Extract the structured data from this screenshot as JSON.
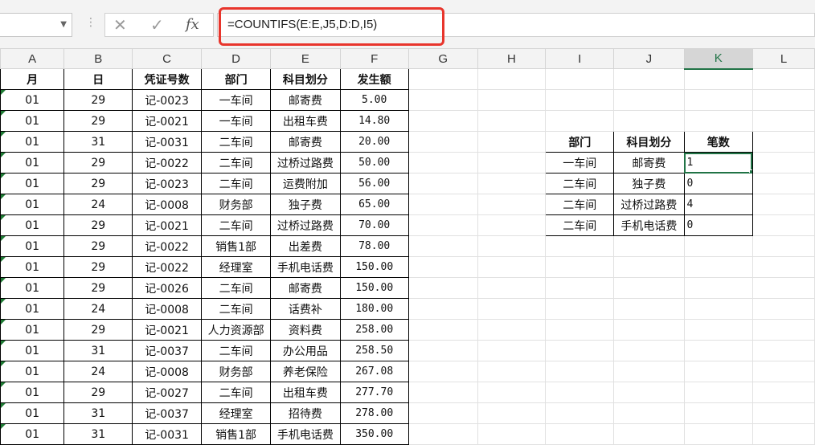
{
  "formula_bar": {
    "name_box": "",
    "cancel_icon": "✕",
    "enter_icon": "✓",
    "fx_label": "fx",
    "formula": "=COUNTIFS(E:E,J5,D:D,I5)"
  },
  "columns": [
    "A",
    "B",
    "C",
    "D",
    "E",
    "F",
    "G",
    "H",
    "I",
    "J",
    "K",
    "L"
  ],
  "selected_column": "K",
  "headers": {
    "month": "月",
    "day": "日",
    "voucher": "凭证号数",
    "dept": "部门",
    "subject": "科目划分",
    "amount": "发生额"
  },
  "rows": [
    {
      "month": "01",
      "day": "29",
      "voucher": "记-0023",
      "dept": "一车间",
      "subject": "邮寄费",
      "amount": "5.00"
    },
    {
      "month": "01",
      "day": "29",
      "voucher": "记-0021",
      "dept": "一车间",
      "subject": "出租车费",
      "amount": "14.80"
    },
    {
      "month": "01",
      "day": "31",
      "voucher": "记-0031",
      "dept": "二车间",
      "subject": "邮寄费",
      "amount": "20.00"
    },
    {
      "month": "01",
      "day": "29",
      "voucher": "记-0022",
      "dept": "二车间",
      "subject": "过桥过路费",
      "amount": "50.00"
    },
    {
      "month": "01",
      "day": "29",
      "voucher": "记-0023",
      "dept": "二车间",
      "subject": "运费附加",
      "amount": "56.00"
    },
    {
      "month": "01",
      "day": "24",
      "voucher": "记-0008",
      "dept": "财务部",
      "subject": "独子费",
      "amount": "65.00"
    },
    {
      "month": "01",
      "day": "29",
      "voucher": "记-0021",
      "dept": "二车间",
      "subject": "过桥过路费",
      "amount": "70.00"
    },
    {
      "month": "01",
      "day": "29",
      "voucher": "记-0022",
      "dept": "销售1部",
      "subject": "出差费",
      "amount": "78.00"
    },
    {
      "month": "01",
      "day": "29",
      "voucher": "记-0022",
      "dept": "经理室",
      "subject": "手机电话费",
      "amount": "150.00"
    },
    {
      "month": "01",
      "day": "29",
      "voucher": "记-0026",
      "dept": "二车间",
      "subject": "邮寄费",
      "amount": "150.00"
    },
    {
      "month": "01",
      "day": "24",
      "voucher": "记-0008",
      "dept": "二车间",
      "subject": "话费补",
      "amount": "180.00"
    },
    {
      "month": "01",
      "day": "29",
      "voucher": "记-0021",
      "dept": "人力资源部",
      "subject": "资料费",
      "amount": "258.00"
    },
    {
      "month": "01",
      "day": "31",
      "voucher": "记-0037",
      "dept": "二车间",
      "subject": "办公用品",
      "amount": "258.50"
    },
    {
      "month": "01",
      "day": "24",
      "voucher": "记-0008",
      "dept": "财务部",
      "subject": "养老保险",
      "amount": "267.08"
    },
    {
      "month": "01",
      "day": "29",
      "voucher": "记-0027",
      "dept": "二车间",
      "subject": "出租车费",
      "amount": "277.70"
    },
    {
      "month": "01",
      "day": "31",
      "voucher": "记-0037",
      "dept": "经理室",
      "subject": "招待费",
      "amount": "278.00"
    },
    {
      "month": "01",
      "day": "31",
      "voucher": "记-0031",
      "dept": "销售1部",
      "subject": "手机电话费",
      "amount": "350.00"
    }
  ],
  "summary": {
    "headers": {
      "dept": "部门",
      "subject": "科目划分",
      "count": "笔数"
    },
    "rows": [
      {
        "dept": "一车间",
        "subject": "邮寄费",
        "count": "1"
      },
      {
        "dept": "二车间",
        "subject": "独子费",
        "count": "0"
      },
      {
        "dept": "二车间",
        "subject": "过桥过路费",
        "count": "4"
      },
      {
        "dept": "二车间",
        "subject": "手机电话费",
        "count": "0"
      }
    ]
  },
  "colors": {
    "highlight": "#e8352c",
    "selection": "#217346",
    "triangle": "#1e7b34"
  }
}
